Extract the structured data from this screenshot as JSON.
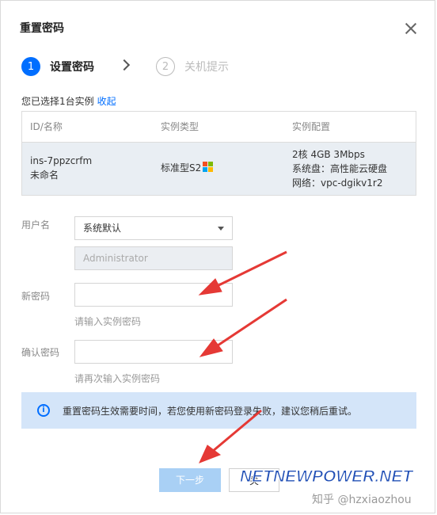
{
  "dialog": {
    "title": "重置密码",
    "steps": [
      {
        "number": "1",
        "label": "设置密码"
      },
      {
        "number": "2",
        "label": "关机提示"
      }
    ],
    "selected_text": "您已选择1台实例",
    "collapse_link": "收起",
    "table": {
      "headers": [
        "ID/名称",
        "实例类型",
        "实例配置"
      ],
      "row": {
        "id": "ins-7ppzcrfm",
        "name": "未命名",
        "type": "标准型S2",
        "config": [
          "2核 4GB 3Mbps",
          "系统盘：高性能云硬盘",
          "网络：vpc-dgikv1r2"
        ]
      }
    },
    "form": {
      "username_label": "用户名",
      "username_select": "系统默认",
      "username_value": "Administrator",
      "new_password_label": "新密码",
      "new_password_hint": "请输入实例密码",
      "confirm_password_label": "确认密码",
      "confirm_password_hint": "请再次输入实例密码"
    },
    "notice": "重置密码生效需要时间，若您使用新密码登录失败，建议您稍后重试。",
    "buttons": {
      "next": "下一步",
      "cancel": "关"
    },
    "colors": {
      "accent": "#006eff",
      "arrow": "#e53935",
      "notice_bg": "#d4e5f9",
      "table_row_bg": "#e9eef3"
    }
  },
  "watermarks": {
    "brand": "NETNEWPOWER.NET",
    "zhihu": "知乎 @hzxiaozhou"
  }
}
